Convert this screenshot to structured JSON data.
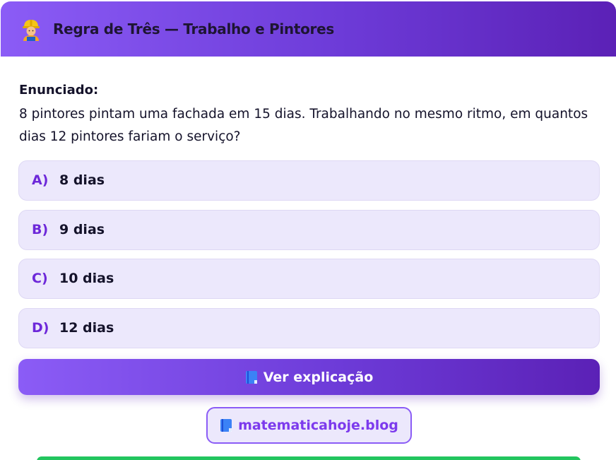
{
  "header": {
    "icon": "construction-worker-icon",
    "title": "Regra de Três — Trabalho e Pintores"
  },
  "question": {
    "label": "Enunciado:",
    "text": "8 pintores pintam uma fachada em 15 dias. Trabalhando no mesmo ritmo, em quantos dias 12 pintores fariam o serviço?"
  },
  "options": [
    {
      "letter": "A)",
      "text": "8 dias"
    },
    {
      "letter": "B)",
      "text": "9 dias"
    },
    {
      "letter": "C)",
      "text": "10 dias"
    },
    {
      "letter": "D)",
      "text": "12 dias"
    }
  ],
  "explain_button": {
    "icon": "book-icon",
    "label": "Ver explicação"
  },
  "blog_link": {
    "icon": "book-icon",
    "label": "matematicahoje.blog"
  },
  "colors": {
    "accent": "#7c3aed",
    "option_bg": "#ece8fc",
    "green": "#22c55e"
  }
}
